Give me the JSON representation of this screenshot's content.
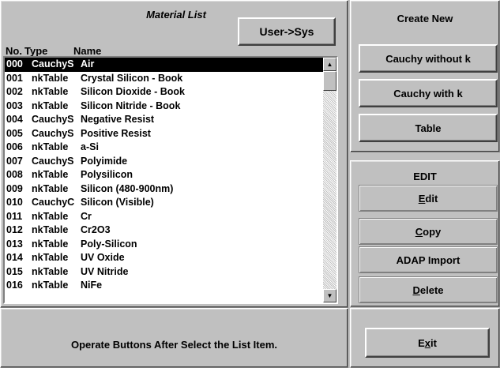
{
  "material_list": {
    "title": "Material List",
    "user_sys_label": "User->Sys",
    "columns": {
      "no": "No.",
      "type": "Type",
      "name": "Name"
    },
    "items": [
      {
        "no": "000",
        "type": "CauchyS",
        "name": "Air",
        "selected": true
      },
      {
        "no": "001",
        "type": "nkTable",
        "name": "Crystal Silicon - Book"
      },
      {
        "no": "002",
        "type": "nkTable",
        "name": "Silicon Dioxide - Book"
      },
      {
        "no": "003",
        "type": "nkTable",
        "name": "Silicon Nitride - Book"
      },
      {
        "no": "004",
        "type": "CauchyS",
        "name": "Negative Resist"
      },
      {
        "no": "005",
        "type": "CauchyS",
        "name": "Positive Resist"
      },
      {
        "no": "006",
        "type": "nkTable",
        "name": "a-Si"
      },
      {
        "no": "007",
        "type": "CauchyS",
        "name": "Polyimide"
      },
      {
        "no": "008",
        "type": "nkTable",
        "name": "Polysilicon"
      },
      {
        "no": "009",
        "type": "nkTable",
        "name": "Silicon (480-900nm)"
      },
      {
        "no": "010",
        "type": "CauchyC",
        "name": "Silicon (Visible)"
      },
      {
        "no": "011",
        "type": "nkTable",
        "name": "Cr"
      },
      {
        "no": "012",
        "type": "nkTable",
        "name": "Cr2O3"
      },
      {
        "no": "013",
        "type": "nkTable",
        "name": "Poly-Silicon"
      },
      {
        "no": "014",
        "type": "nkTable",
        "name": "UV Oxide"
      },
      {
        "no": "015",
        "type": "nkTable",
        "name": "UV Nitride"
      },
      {
        "no": "016",
        "type": "nkTable",
        "name": "NiFe"
      }
    ]
  },
  "status": {
    "text": "Operate Buttons After Select the List Item."
  },
  "create_new": {
    "title": "Create New",
    "cauchy_without_k": "Cauchy without k",
    "cauchy_with_k": "Cauchy with k",
    "table": "Table"
  },
  "edit": {
    "title": "EDIT",
    "edit_label": "Edit",
    "copy_label": "Copy",
    "adap_import_label": "ADAP Import",
    "delete_label": "Delete"
  },
  "exit": {
    "label": "Exit"
  },
  "icons": {
    "scroll_up": "up-arrow-icon",
    "scroll_down": "down-arrow-icon"
  },
  "colors": {
    "face": "#c0c0c0",
    "selection": "#000000",
    "list_bg": "#ffffff"
  }
}
